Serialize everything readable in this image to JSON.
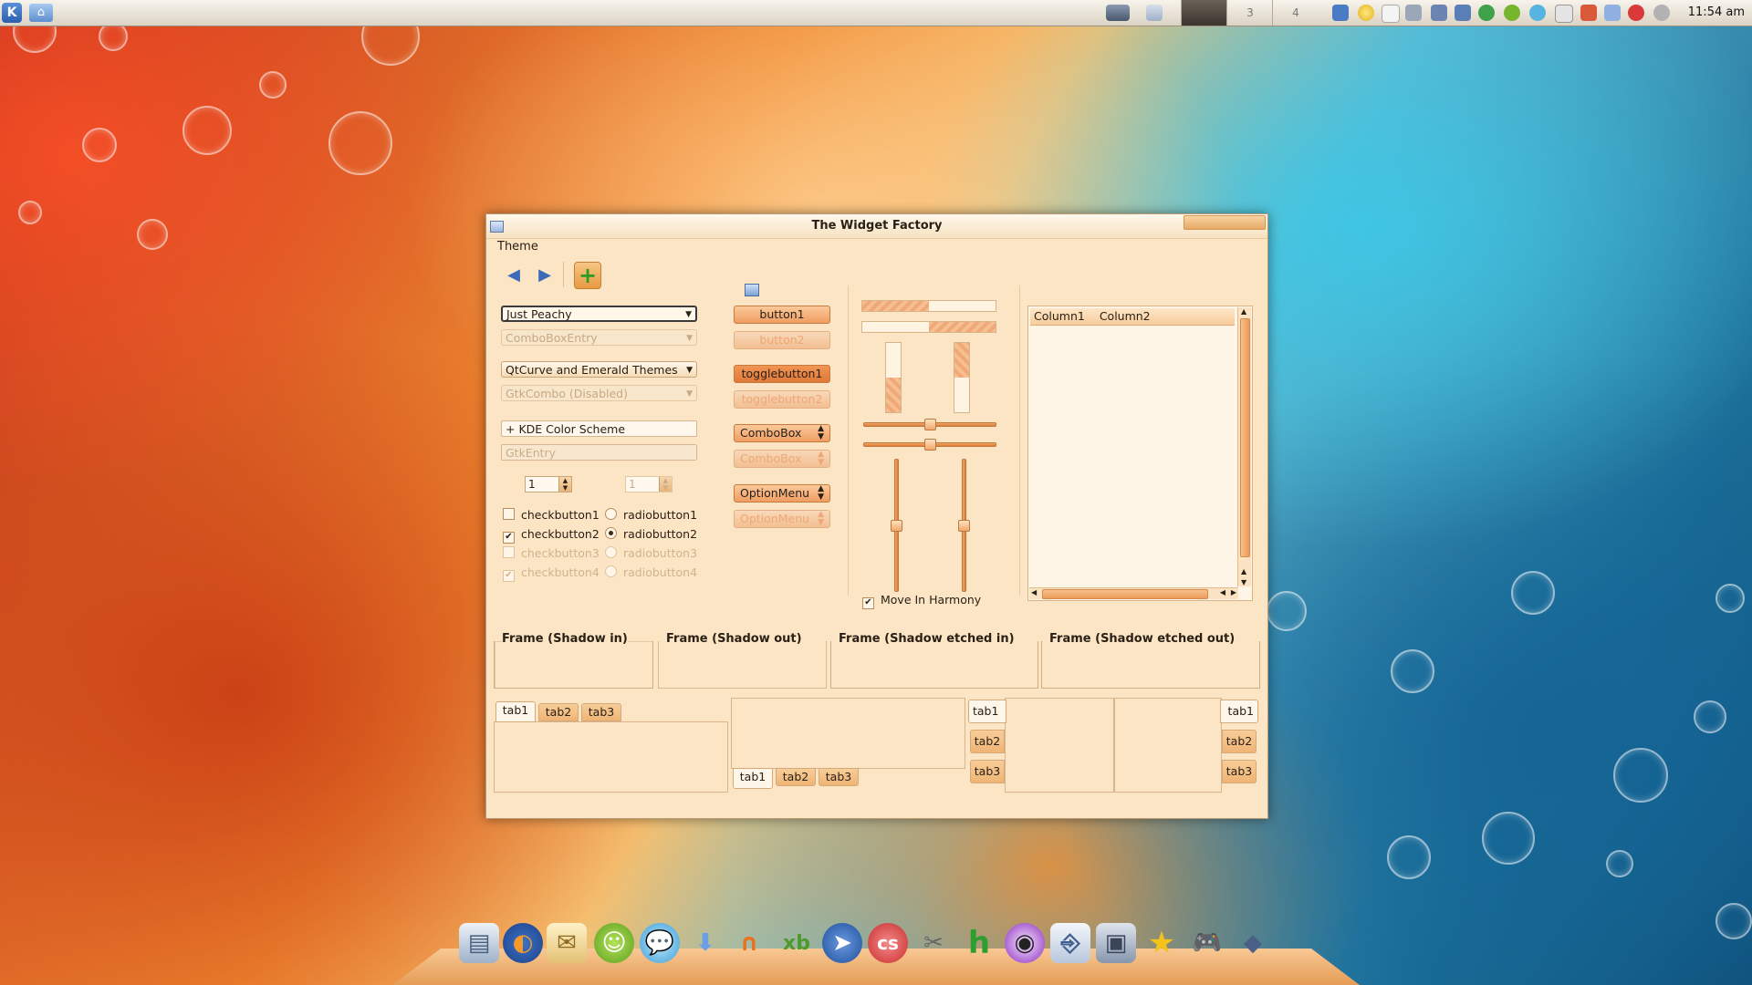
{
  "panel": {
    "pagers": [
      "3",
      "4"
    ],
    "clock": "11:54 am"
  },
  "window": {
    "title": "The Widget Factory",
    "menu": [
      "Theme"
    ]
  },
  "toolbar": {
    "back_icon": "back-arrow-icon",
    "forward_icon": "forward-arrow-icon",
    "add_icon": "add-icon"
  },
  "left": {
    "combo_entry_value": "Just Peachy",
    "combo_entry_disabled": "ComboBoxEntry",
    "combo_1": "QtCurve and Emerald Themes",
    "combo_disabled": "GtkCombo (Disabled)",
    "entry_value": "+ KDE Color Scheme",
    "entry_disabled": "GtkEntry",
    "spin_1": "1",
    "spin_2": "1",
    "checks": [
      {
        "label": "checkbutton1",
        "checked": false,
        "disabled": false
      },
      {
        "label": "checkbutton2",
        "checked": true,
        "disabled": false
      },
      {
        "label": "checkbutton3",
        "checked": false,
        "disabled": true
      },
      {
        "label": "checkbutton4",
        "checked": true,
        "disabled": true
      }
    ],
    "radios": [
      {
        "label": "radiobutton1",
        "checked": false,
        "disabled": false
      },
      {
        "label": "radiobutton2",
        "checked": true,
        "disabled": false
      },
      {
        "label": "radiobutton3",
        "checked": false,
        "disabled": true
      },
      {
        "label": "radiobutton4",
        "checked": true,
        "disabled": true
      }
    ]
  },
  "middle": {
    "button1": "button1",
    "button2": "button2",
    "toggle1": "togglebutton1",
    "toggle2": "togglebutton2",
    "combobox1": "ComboBox",
    "combobox2": "ComboBox",
    "optionmenu1": "OptionMenu",
    "optionmenu2": "OptionMenu"
  },
  "ranges": {
    "move_in_harmony": "Move In Harmony",
    "hprogress": [
      0.5,
      0.5
    ],
    "vprogress": [
      0.5,
      0.5
    ],
    "hscale": [
      0.5,
      0.5
    ],
    "vscale": [
      0.5,
      0.5
    ]
  },
  "tree": {
    "columns": [
      "Column1",
      "Column2"
    ]
  },
  "frames": [
    "Frame (Shadow in)",
    "Frame (Shadow out)",
    "Frame (Shadow etched in)",
    "Frame (Shadow etched out)"
  ],
  "notebooks": [
    {
      "tabs": [
        "tab1",
        "tab2",
        "tab3"
      ],
      "position": "top"
    },
    {
      "tabs": [
        "tab1",
        "tab2",
        "tab3"
      ],
      "position": "bottom"
    },
    {
      "tabs": [
        "tab1",
        "tab2",
        "tab3"
      ],
      "position": "left"
    },
    {
      "tabs": [
        "tab1",
        "tab2",
        "tab3"
      ],
      "position": "right"
    }
  ],
  "dock": [
    "file-manager-icon",
    "firefox-icon",
    "mail-icon",
    "pidgin-icon",
    "chat-icon",
    "download-icon",
    "magnet-icon",
    "xbmc-icon",
    "shark-icon",
    "lastfm-icon",
    "media-icon",
    "h-icon",
    "eye-icon",
    "terminal-icon",
    "installer-icon",
    "star-icon",
    "gamepad-icon",
    "diamond-icon"
  ]
}
